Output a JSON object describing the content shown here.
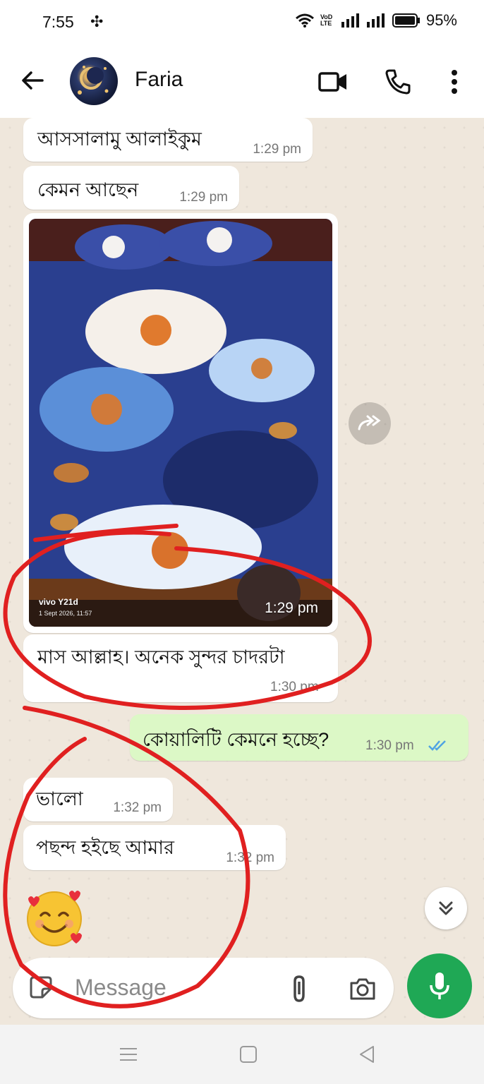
{
  "status_bar": {
    "time": "7:55",
    "carrier_badge": "VoD LTE",
    "battery": "95%"
  },
  "header": {
    "contact_name": "Faria",
    "icons": [
      "back-arrow-icon",
      "video-call-icon",
      "voice-call-icon",
      "more-vertical-icon"
    ]
  },
  "messages": [
    {
      "direction": "in",
      "text": "আসসালামু আলাইকুম",
      "time": "1:29 pm"
    },
    {
      "direction": "in",
      "text": "কেমন আছেন",
      "time": "1:29 pm"
    },
    {
      "direction": "in",
      "type": "image",
      "time": "1:29 pm",
      "watermark_model": "vivo Y21d",
      "watermark_date": "1 Sept 2026, 11:57"
    },
    {
      "direction": "in",
      "text": "মাস আল্লাহ। অনেক সুন্দর চাদরটা",
      "time": "1:30 pm"
    },
    {
      "direction": "out",
      "text": "কোয়ালিটি কেমনে হচ্ছে?",
      "time": "1:30 pm",
      "status": "read"
    },
    {
      "direction": "in",
      "text": "ভালো",
      "time": "1:32 pm"
    },
    {
      "direction": "in",
      "text": "পছন্দ হইছে আমার",
      "time": "1:32 pm"
    },
    {
      "direction": "in",
      "type": "emoji",
      "emoji": "🥰"
    }
  ],
  "input": {
    "placeholder": "Message"
  },
  "colors": {
    "outgoing_bubble": "#dcf8c6",
    "incoming_bubble": "#ffffff",
    "send_button": "#1fa855",
    "read_ticks": "#4fa3e3",
    "annotation_red": "#e02020"
  }
}
